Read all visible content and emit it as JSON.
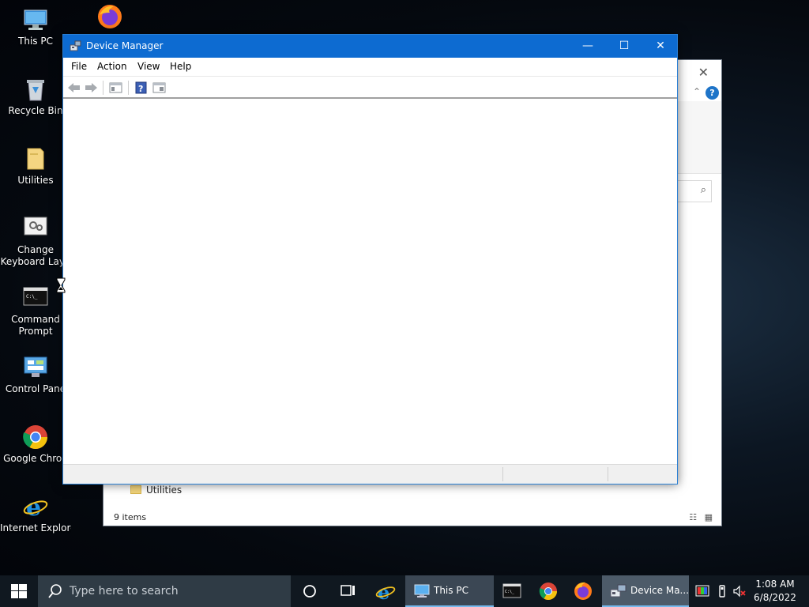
{
  "desktop": {
    "icons": [
      {
        "label": "This PC",
        "icon": "this-pc-icon"
      },
      {
        "label": "",
        "icon": "firefox-icon"
      },
      {
        "label": "Recycle Bin",
        "icon": "recycle-bin-icon"
      },
      {
        "label": "Utilities",
        "icon": "folder-icon"
      },
      {
        "label": "Change Keyboard Layo",
        "label_line1": "Change",
        "label_line2": "Keyboard Layo",
        "icon": "keyboard-settings-icon"
      },
      {
        "label_line1": "Command",
        "label_line2": "Prompt",
        "icon": "command-prompt-icon"
      },
      {
        "label": "Control Pane",
        "icon": "control-panel-icon"
      },
      {
        "label": "Google Chron",
        "icon": "chrome-icon"
      },
      {
        "label": "Internet Explorer",
        "icon": "internet-explorer-icon"
      }
    ]
  },
  "explorer": {
    "folder_item": "Utilities",
    "status": "9 items",
    "help": "?"
  },
  "device_manager": {
    "title": "Device Manager",
    "menu": [
      "File",
      "Action",
      "View",
      "Help"
    ],
    "toolbar": [
      "back-arrow-icon",
      "forward-arrow-icon",
      "show-hide-console-tree-icon",
      "help-icon",
      "properties-icon"
    ],
    "controls": {
      "minimize": "—",
      "maximize": "☐",
      "close": "✕"
    }
  },
  "taskbar": {
    "search_placeholder": "Type here to search",
    "buttons": [
      {
        "label": "This PC",
        "icon": "this-pc-icon"
      },
      {
        "label": "Device Ma...",
        "icon": "device-manager-icon"
      }
    ],
    "clock": {
      "time": "1:08 AM",
      "date": "6/8/2022"
    }
  },
  "colors": {
    "title_bar": "#0d6bd1",
    "taskbar": "#101820",
    "accent": "#76b9ed"
  }
}
